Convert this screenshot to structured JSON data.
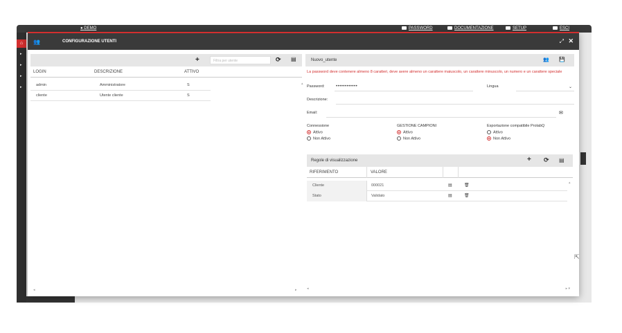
{
  "topbar": {
    "user": "DEMO",
    "items": [
      {
        "label": "PASSWORD",
        "icon": "key-icon"
      },
      {
        "label": "DOCUMENTAZIONE",
        "icon": "folder-icon"
      },
      {
        "label": "SETUP",
        "icon": "gear-icon"
      },
      {
        "label": "ESCI",
        "icon": "power-icon"
      }
    ]
  },
  "modal": {
    "title": "CONFIGURAZIONE UTENTI",
    "expand_glyph": "⤢",
    "close_glyph": "✕"
  },
  "users": {
    "filter_placeholder": "Filtra per utente",
    "columns": [
      "LOGIN",
      "DESCRIZIONE",
      "ATTIVO"
    ],
    "rows": [
      {
        "login": "admin",
        "descrizione": "Amministratore",
        "attivo": "S"
      },
      {
        "login": "cliente",
        "descrizione": "Utente cliente",
        "attivo": "S"
      }
    ]
  },
  "detail": {
    "title": "Nuovo_utente",
    "warning": "La password deve contenere almeno 8 caratteri, deve avere almeno un carattere maiuscolo, un carattere minuscolo, un numero e un carattere speciale",
    "password_label": "Password:",
    "password_value": "••••••••••••",
    "lingua_label": "Lingua",
    "descrizione_label": "Descrizione:",
    "email_label": "Email:",
    "groups": [
      {
        "title": "Connessione",
        "options": [
          "Attivo",
          "Non Attivo"
        ],
        "selected": 0
      },
      {
        "title": "GESTIONE CAMPIONI",
        "options": [
          "Attivo",
          "Non Attivo"
        ],
        "selected": 0
      },
      {
        "title": "Esportazione compatibile ProlabQ",
        "options": [
          "Attivo",
          "Non Attivo"
        ],
        "selected": 1
      }
    ]
  },
  "rules": {
    "title": "Regole di visualizzazione",
    "columns": [
      "RIFERIMENTO",
      "VALORE"
    ],
    "rows": [
      {
        "riferimento": "Cliente",
        "valore": "000021"
      },
      {
        "riferimento": "Stato",
        "valore": "Validato"
      }
    ]
  },
  "colors": {
    "accent": "#d32f2f",
    "header": "#3a3a3a",
    "toolbar": "#e6e6e6"
  }
}
